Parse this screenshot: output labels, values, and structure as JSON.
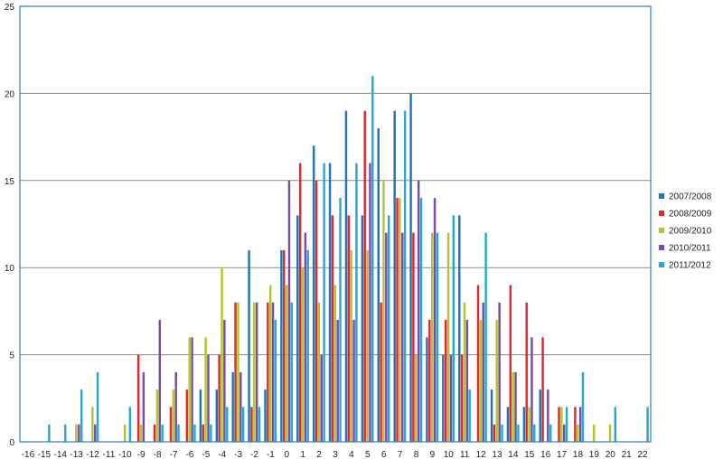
{
  "chart_data": {
    "type": "bar",
    "categories": [
      "-16",
      "-15",
      "-14",
      "-13",
      "-12",
      "-11",
      "-10",
      "-9",
      "-8",
      "-7",
      "-6",
      "-5",
      "-4",
      "-3",
      "-2",
      "-1",
      "0",
      "1",
      "2",
      "3",
      "4",
      "5",
      "6",
      "7",
      "8",
      "9",
      "10",
      "11",
      "12",
      "13",
      "14",
      "15",
      "16",
      "17",
      "18",
      "19",
      "20",
      "21",
      "22"
    ],
    "ylim": [
      0,
      25
    ],
    "yticks": [
      0,
      5,
      10,
      15,
      20,
      25
    ],
    "grid": true,
    "legend_position": "right",
    "series": [
      {
        "name": "2007/2008",
        "color": "#1f78b4",
        "values": [
          0,
          0,
          0,
          0,
          0,
          0,
          0,
          0,
          0,
          0,
          0,
          3,
          3,
          4,
          11,
          3,
          11,
          13,
          17,
          16,
          19,
          13,
          18,
          19,
          20,
          6,
          5,
          13,
          0,
          3,
          2,
          2,
          3,
          0,
          0,
          0,
          0,
          0,
          0
        ]
      },
      {
        "name": "2008/2009",
        "color": "#e3262f",
        "values": [
          0,
          0,
          0,
          0,
          0,
          0,
          0,
          5,
          1,
          2,
          3,
          1,
          5,
          8,
          2,
          8,
          11,
          16,
          15,
          13,
          13,
          19,
          8,
          14,
          12,
          7,
          7,
          5,
          9,
          1,
          9,
          8,
          6,
          2,
          2,
          0,
          0,
          0,
          0
        ]
      },
      {
        "name": "2009/2010",
        "color": "#b5c42d",
        "values": [
          0,
          0,
          0,
          1,
          2,
          0,
          1,
          1,
          3,
          3,
          6,
          6,
          10,
          8,
          8,
          9,
          9,
          10,
          8,
          9,
          11,
          11,
          15,
          14,
          5,
          12,
          12,
          8,
          7,
          7,
          4,
          2,
          0,
          2,
          1,
          1,
          1,
          0,
          0
        ]
      },
      {
        "name": "2010/2011",
        "color": "#7a4ca8",
        "values": [
          0,
          0,
          0,
          1,
          1,
          0,
          0,
          4,
          7,
          4,
          6,
          5,
          7,
          4,
          8,
          8,
          15,
          12,
          5,
          7,
          7,
          16,
          12,
          12,
          15,
          14,
          5,
          7,
          8,
          8,
          4,
          6,
          3,
          1,
          2,
          0,
          0,
          0,
          0
        ]
      },
      {
        "name": "2011/2012",
        "color": "#23a9d3",
        "values": [
          0,
          1,
          1,
          3,
          4,
          0,
          2,
          0,
          1,
          1,
          1,
          1,
          2,
          2,
          2,
          7,
          8,
          11,
          16,
          14,
          16,
          21,
          13,
          19,
          14,
          12,
          13,
          3,
          12,
          1,
          1,
          1,
          1,
          2,
          4,
          0,
          2,
          0,
          2
        ]
      }
    ]
  }
}
